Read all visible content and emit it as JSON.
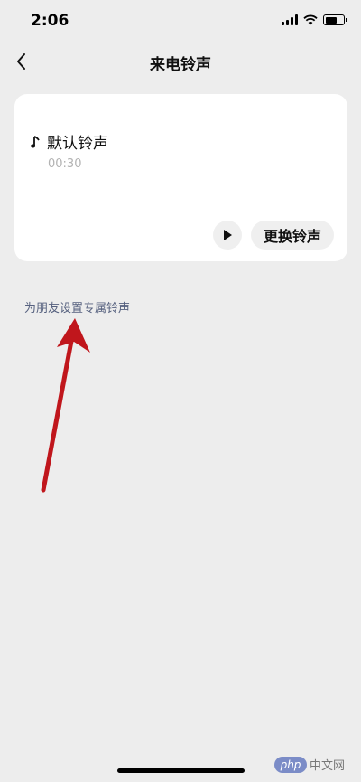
{
  "status_bar": {
    "time": "2:06",
    "battery_level": 0.65
  },
  "nav": {
    "title": "来电铃声",
    "back_icon": "chevron-left-icon"
  },
  "ringtone_card": {
    "name": "默认铃声",
    "duration": "00:30",
    "note_icon": "music-note-icon",
    "play_icon": "play-icon",
    "change_label": "更换铃声"
  },
  "friend_link": {
    "label": "为朋友设置专属铃声"
  },
  "annotation": {
    "color": "#c0161c"
  },
  "watermark": {
    "logo": "php",
    "text": "中文网"
  }
}
